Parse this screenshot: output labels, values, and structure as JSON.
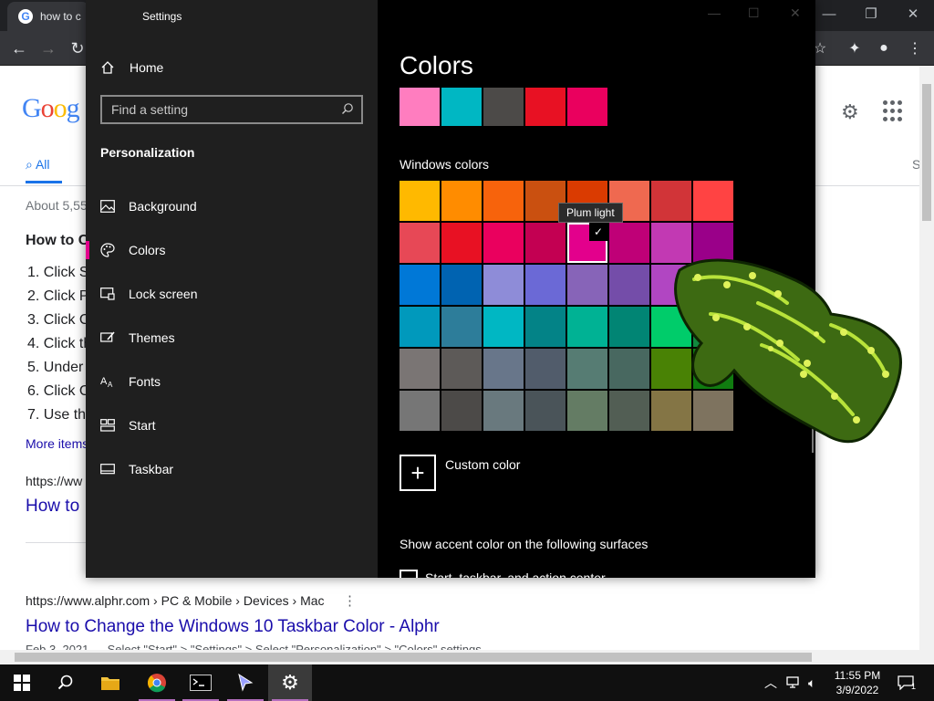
{
  "browser": {
    "tab_title": "how to c",
    "google": {
      "logo": [
        "G",
        "o",
        "o",
        "g"
      ],
      "tab_all": "All",
      "about": "About 5,55",
      "heading": "How to C",
      "steps": [
        "1. Click S",
        "2. Click P",
        "3. Click C",
        "4. Click th",
        "5. Under",
        "6. Click C",
        "7. Use th"
      ],
      "more_items": "More items",
      "cite1": "https://ww",
      "link1": "How to",
      "cite2": "https://www.alphr.com › PC & Mobile › Devices › Mac",
      "link2": "How to Change the Windows 10 Taskbar Color - Alphr",
      "snippet2": "Feb 3, 2021 — Select \"Start\" > \"Settings\" > Select \"Personalization\" > \"Colors\" settings",
      "right_letter": "S"
    }
  },
  "settings": {
    "app_title": "Settings",
    "home_label": "Home",
    "search_placeholder": "Find a setting",
    "section_title": "Personalization",
    "nav_items": [
      {
        "label": "Background",
        "icon": "image-icon"
      },
      {
        "label": "Colors",
        "icon": "palette-icon"
      },
      {
        "label": "Lock screen",
        "icon": "lock-screen-icon"
      },
      {
        "label": "Themes",
        "icon": "themes-icon"
      },
      {
        "label": "Fonts",
        "icon": "fonts-icon"
      },
      {
        "label": "Start",
        "icon": "start-icon"
      },
      {
        "label": "Taskbar",
        "icon": "taskbar-icon"
      }
    ],
    "selected_nav": "Colors",
    "page_title": "Colors",
    "recent_colors": [
      "#ff7dbf",
      "#00b7c3",
      "#4c4a48",
      "#e81123",
      "#ea005e"
    ],
    "windows_colors_label": "Windows colors",
    "tooltip": "Plum light",
    "windows_colors": [
      "#ffb900",
      "#ff8c00",
      "#f7630c",
      "#ca5010",
      "#da3b01",
      "#ef6950",
      "#d13438",
      "#ff4343",
      "#e74856",
      "#e81123",
      "#ea005e",
      "#c30052",
      "#e3008c",
      "#bf0077",
      "#c239b3",
      "#9a0089",
      "#0078d7",
      "#0063b1",
      "#8e8cd8",
      "#6b69d6",
      "#8764b8",
      "#744da9",
      "#b146c2",
      "#881798",
      "#0099bc",
      "#2d7d9a",
      "#00b7c3",
      "#038387",
      "#00b294",
      "#018574",
      "#00cc6a",
      "#10893e",
      "#7a7574",
      "#5d5a58",
      "#68768a",
      "#515c6b",
      "#567c73",
      "#486860",
      "#498205",
      "#107c10",
      "#767676",
      "#4c4a48",
      "#69797e",
      "#4a5459",
      "#647c64",
      "#525e54",
      "#847545",
      "#7e735f"
    ],
    "selected_color": "#e3008c",
    "custom_color_label": "Custom color",
    "show_accent_label": "Show accent color on the following surfaces",
    "checkbox_label": "Start, taskbar, and action center"
  },
  "taskbar": {
    "time": "11:55 PM",
    "date": "3/9/2022",
    "notification_count": "1"
  }
}
